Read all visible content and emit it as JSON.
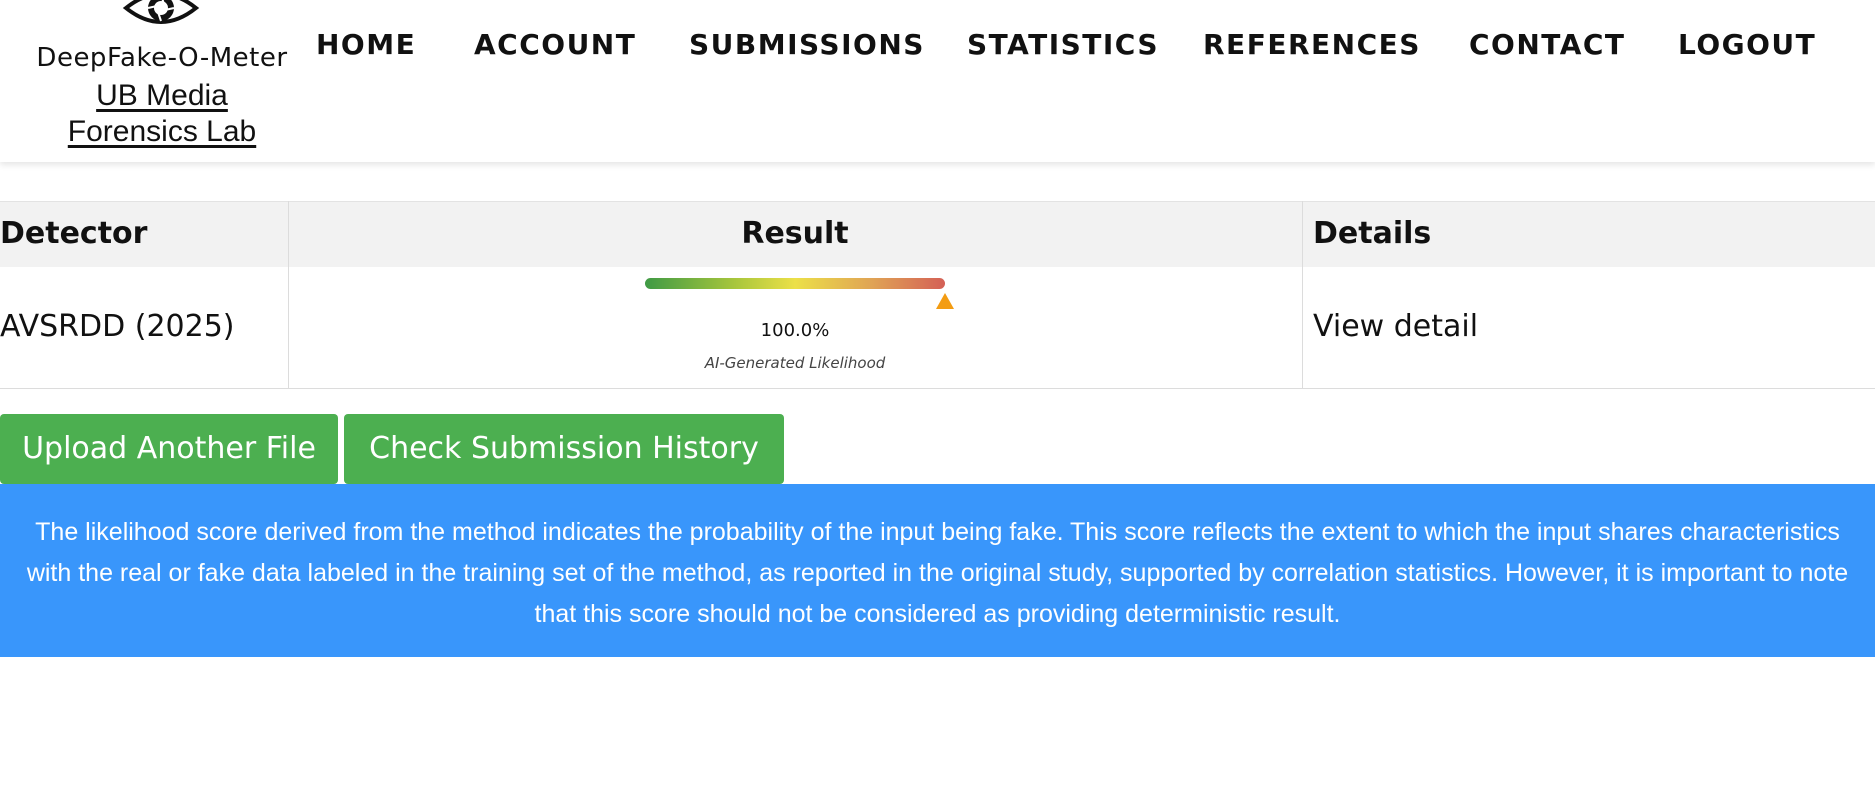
{
  "brand": {
    "name": "DeepFake-O-Meter",
    "lab": "UB Media Forensics Lab"
  },
  "nav": {
    "items": [
      "HOME",
      "ACCOUNT",
      "SUBMISSIONS",
      "STATISTICS",
      "REFERENCES",
      "CONTACT",
      "LOGOUT"
    ]
  },
  "table": {
    "headers": {
      "detector": "Detector",
      "result": "Result",
      "details": "Details"
    },
    "rows": [
      {
        "detector": "AVSRDD (2025)",
        "likelihood_percent": 100.0,
        "likelihood_text": "100.0%",
        "likelihood_label": "AI-Generated Likelihood",
        "details": "View detail"
      }
    ]
  },
  "buttons": {
    "upload": "Upload Another File",
    "history": "Check Submission History"
  },
  "info": {
    "text": "The likelihood score derived from the method indicates the probability of the input being fake. This score reflects the extent to which the input shares characteristics with the real or fake data labeled in the training set of the method, as reported in the original study, supported by correlation statistics. However, it is important to note that this score should not be considered as providing deterministic result."
  },
  "colors": {
    "button_green": "#4caf50",
    "banner_blue": "#3996fb",
    "marker_orange": "#f39c12",
    "gauge_low": "#3f9a45",
    "gauge_mid": "#ece048",
    "gauge_high": "#d46056"
  },
  "icons": {
    "logo": "eye-aperture-icon",
    "gauge_marker": "triangle-up-icon"
  }
}
